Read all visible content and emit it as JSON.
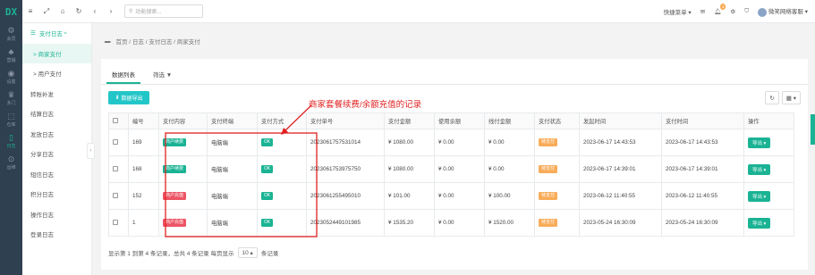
{
  "rail": {
    "logo": "DX",
    "items": [
      {
        "glyph": "⚙",
        "label": "会员"
      },
      {
        "glyph": "♣",
        "label": "营销"
      },
      {
        "glyph": "◉",
        "label": "设置"
      },
      {
        "glyph": "♛",
        "label": "多门"
      },
      {
        "glyph": "⬚",
        "label": "仓库"
      },
      {
        "glyph": "▯",
        "label": "日志"
      },
      {
        "glyph": "⊙",
        "label": "运维"
      }
    ]
  },
  "submenu": {
    "head": "支付日志 ^",
    "items": [
      {
        "label": "> 商家支付",
        "sel": true
      },
      {
        "label": "> 用户支付",
        "child": true
      },
      {
        "label": "转账补发"
      },
      {
        "label": "结算日志"
      },
      {
        "label": "发放日志"
      },
      {
        "label": "分享日志"
      },
      {
        "label": "短信日志"
      },
      {
        "label": "积分日志"
      },
      {
        "label": "操作日志"
      },
      {
        "label": "登录日志"
      }
    ]
  },
  "topbar": {
    "search_placeholder": "功能搜索...",
    "quick_menu": "快捷菜单 ▾",
    "notif_count": "1",
    "username": "微笑网络客服 ▾"
  },
  "breadcrumb": "首页 / 日志 / 支付日志 / 商家支付",
  "tabs": [
    "数据列表",
    "筛选 ▼"
  ],
  "export_label": "数据导出",
  "annotation": "商家套餐续费/余额充值的记录",
  "table": {
    "headers": [
      "编号",
      "支付内容",
      "支付终端",
      "支付方式",
      "支付单号",
      "支付金额",
      "使用余额",
      "线付金额",
      "支付状态",
      "发起时间",
      "支付时间",
      "操作"
    ],
    "rows": [
      {
        "id": "169",
        "content": "商户续费",
        "terminal": "电脑端",
        "method": "OK",
        "order": "2023061757531014",
        "amount": "¥ 1080.00",
        "balance": "¥ 0.00",
        "paid": "¥ 0.00",
        "status": "待支付",
        "start": "2023-06-17 14:43:53",
        "paytime": "2023-06-17 14:43:53",
        "op": "导出 ▾"
      },
      {
        "id": "168",
        "content": "商户续费",
        "terminal": "电脑端",
        "method": "OK",
        "order": "2023061753975750",
        "amount": "¥ 1080.00",
        "balance": "¥ 0.00",
        "paid": "¥ 0.00",
        "status": "待支付",
        "start": "2023-06-17 14:39:01",
        "paytime": "2023-06-17 14:39:01",
        "op": "导出 ▾"
      },
      {
        "id": "152",
        "content": "商户充值",
        "terminal": "电脑端",
        "method": "OK",
        "order": "2023061255495010",
        "amount": "¥ 101.00",
        "balance": "¥ 0.00",
        "paid": "¥ 100.00",
        "status": "待支付",
        "start": "2023-06-12 11:40:55",
        "paytime": "2023-06-12 11:40:55",
        "op": "导出 ▾"
      },
      {
        "id": "1",
        "content": "商户充值",
        "terminal": "电脑端",
        "method": "OK",
        "order": "2023052449101985",
        "amount": "¥ 1535.20",
        "balance": "¥ 0.00",
        "paid": "¥ 1520.00",
        "status": "待支付",
        "start": "2023-05-24 16:30:09",
        "paytime": "2023-05-24 16:30:09",
        "op": "导出 ▾"
      }
    ]
  },
  "footer": {
    "summary": "显示第 1 到第 4 条记录，总共 4 条记录 每页显示",
    "page_size": "10 ▴",
    "suffix": "条记录"
  },
  "colors": {
    "accent": "#1ab394",
    "rail": "#2f4050",
    "export": "#23c6c8",
    "annotation": "#e02020"
  }
}
